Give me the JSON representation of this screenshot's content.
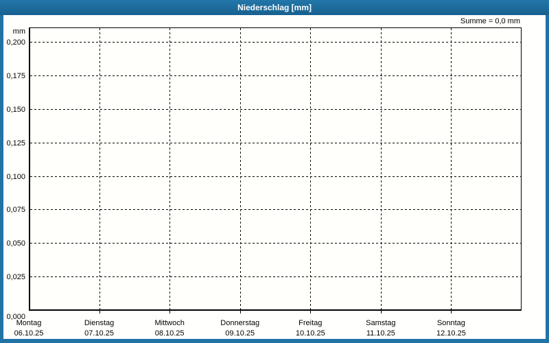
{
  "window": {
    "title": "Niederschlag [mm]"
  },
  "chart_data": {
    "type": "bar",
    "title": "Niederschlag [mm]",
    "ylabel": "mm",
    "sum_label": "Summe = 0,0 mm",
    "categories": [
      "Montag",
      "Dienstag",
      "Mittwoch",
      "Donnerstag",
      "Freitag",
      "Samstag",
      "Sonntag"
    ],
    "dates": [
      "06.10.25",
      "07.10.25",
      "08.10.25",
      "09.10.25",
      "10.10.25",
      "11.10.25",
      "12.10.25"
    ],
    "values": [
      0,
      0,
      0,
      0,
      0,
      0,
      0
    ],
    "ylim": [
      0,
      0.2
    ],
    "y_tick_step": 0.025,
    "y_ticks": [
      "0,000",
      "0,025",
      "0,050",
      "0,075",
      "0,100",
      "0,125",
      "0,150",
      "0,175",
      "0,200"
    ],
    "grid": "dashed",
    "legend": "none"
  },
  "colors": {
    "titlebar": "#1d6b9c",
    "frame": "#2273a5",
    "title_text": "#ffffff",
    "grid": "#000000",
    "text": "#000000",
    "background": "#fffffd",
    "plot_background": "#fffffb"
  }
}
